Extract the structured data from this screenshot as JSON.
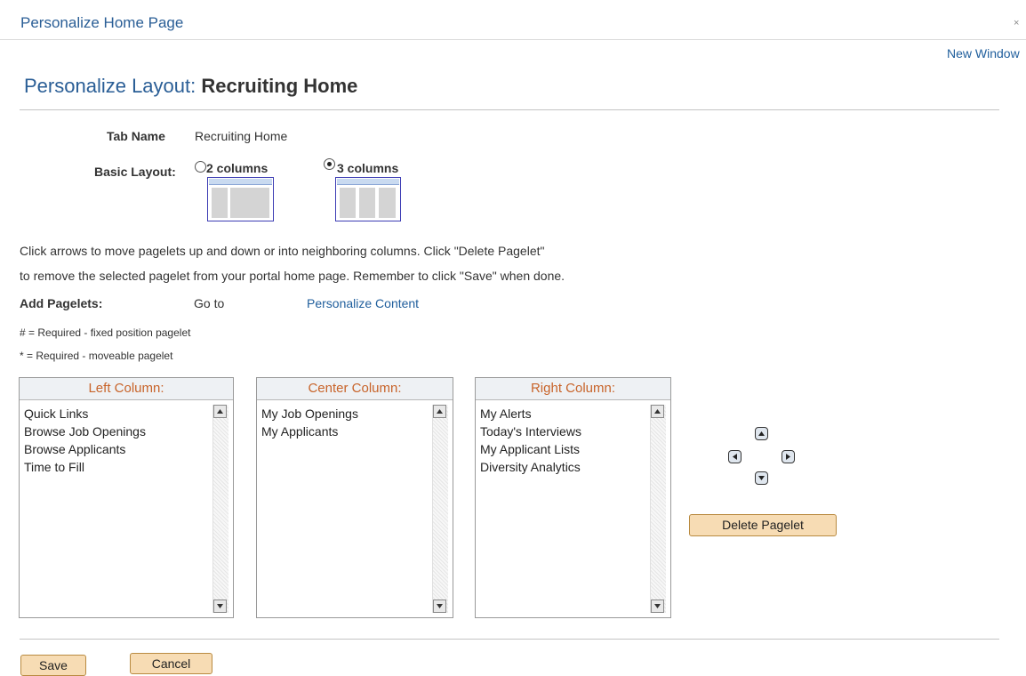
{
  "window": {
    "title": "Personalize Home Page",
    "close": "×",
    "new_window": "New Window"
  },
  "heading": {
    "prefix": "Personalize Layout:",
    "name": "Recruiting Home"
  },
  "tab_name": {
    "label": "Tab Name",
    "value": "Recruiting Home"
  },
  "basic_layout": {
    "label": "Basic Layout:",
    "options": [
      {
        "label": "2 columns",
        "selected": false
      },
      {
        "label": "3 columns",
        "selected": true
      }
    ]
  },
  "instructions": {
    "line1": "Click arrows to move pagelets up and down or into neighboring columns. Click \"Delete Pagelet\"",
    "line2": "to remove the selected pagelet from your portal home page. Remember to click \"Save\" when done."
  },
  "add_pagelets": {
    "label": "Add Pagelets:",
    "goto": "Go to",
    "link": "Personalize Content"
  },
  "legend": {
    "fixed": "# = Required - fixed position pagelet",
    "moveable": "* = Required - moveable pagelet"
  },
  "columns": {
    "left": {
      "title": "Left Column:",
      "items": [
        "Quick Links",
        "Browse Job Openings",
        "Browse Applicants",
        "Time to Fill"
      ]
    },
    "center": {
      "title": "Center Column:",
      "items": [
        "My Job Openings",
        "My Applicants"
      ]
    },
    "right": {
      "title": "Right Column:",
      "items": [
        "My Alerts",
        "Today's Interviews",
        "My Applicant Lists",
        "Diversity Analytics"
      ]
    }
  },
  "buttons": {
    "delete": "Delete Pagelet",
    "save": "Save",
    "cancel": "Cancel"
  },
  "icons": [
    "close-icon",
    "arrow-up-icon",
    "arrow-left-icon",
    "arrow-right-icon",
    "arrow-down-icon",
    "scroll-up-icon",
    "scroll-down-icon"
  ],
  "colors": {
    "title": "#2a5e96",
    "column_header": "#c8642a",
    "button": "#f7dcb4",
    "link": "#1f5e9c"
  }
}
